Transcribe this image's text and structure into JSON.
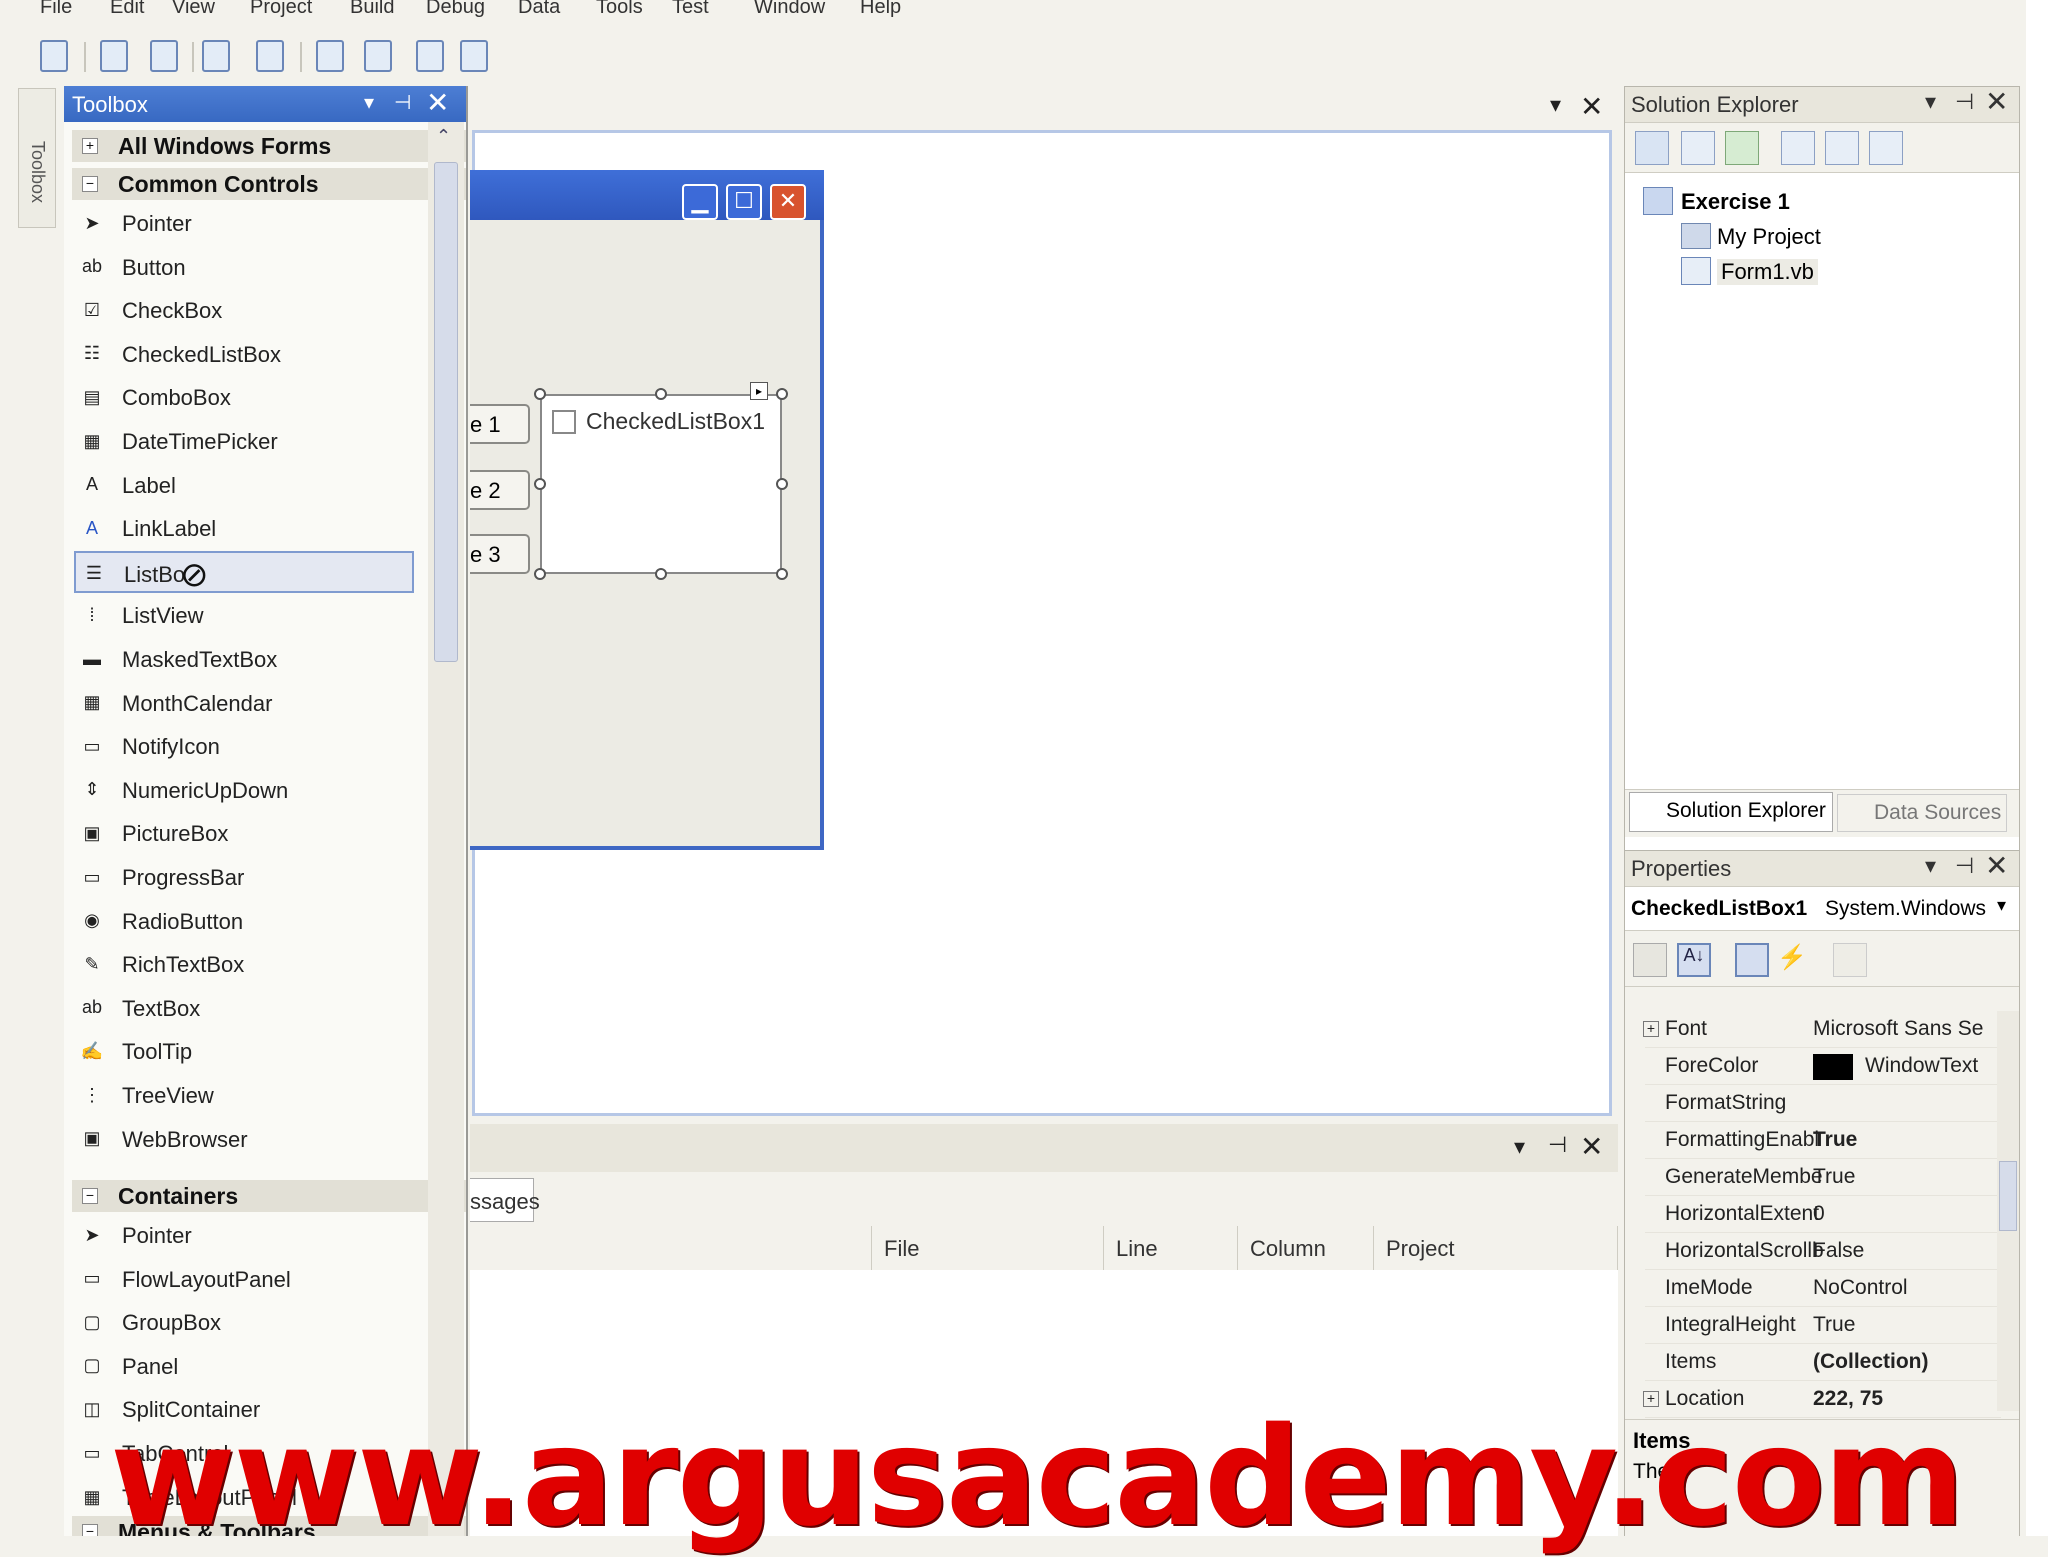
{
  "menu": [
    "File",
    "Edit",
    "View",
    "Project",
    "Build",
    "Debug",
    "Data",
    "Tools",
    "Test",
    "Window",
    "Help"
  ],
  "toolbox": {
    "title": "Toolbox",
    "side_tab": "Toolbox",
    "categories": [
      {
        "label": "All Windows Forms",
        "expanded": false
      },
      {
        "label": "Common Controls",
        "expanded": true
      },
      {
        "label": "Containers",
        "expanded": true
      },
      {
        "label": "Menus & Toolbars",
        "expanded": true
      }
    ],
    "common_controls": [
      "Pointer",
      "Button",
      "CheckBox",
      "CheckedListBox",
      "ComboBox",
      "DateTimePicker",
      "Label",
      "LinkLabel",
      "ListBox",
      "ListView",
      "MaskedTextBox",
      "MonthCalendar",
      "NotifyIcon",
      "NumericUpDown",
      "PictureBox",
      "ProgressBar",
      "RadioButton",
      "RichTextBox",
      "TextBox",
      "ToolTip",
      "TreeView",
      "WebBrowser"
    ],
    "containers": [
      "Pointer",
      "FlowLayoutPanel",
      "GroupBox",
      "Panel",
      "SplitContainer",
      "TabControl",
      "TableLayoutPanel"
    ],
    "selected": "ListBox",
    "selected_visible": "ListBo"
  },
  "designer": {
    "form_buttons": [
      "e 1",
      "e 2",
      "e 3"
    ],
    "checked_list_box": "CheckedListBox1"
  },
  "output": {
    "tab_partial": "ssages",
    "columns": [
      "File",
      "Line",
      "Column",
      "Project"
    ]
  },
  "solution_explorer": {
    "title": "Solution Explorer",
    "tree": [
      "Exercise 1",
      "My Project",
      "Form1.vb"
    ],
    "tabs": [
      "Solution Explorer",
      "Data Sources"
    ]
  },
  "properties": {
    "title": "Properties",
    "object_name": "CheckedListBox1",
    "object_type": "System.Windows",
    "rows": [
      {
        "name": "Font",
        "value": "Microsoft Sans Se",
        "expander": true,
        "bold": false
      },
      {
        "name": "ForeColor",
        "value": "WindowText",
        "swatch": "#000000",
        "bold": false
      },
      {
        "name": "FormatString",
        "value": "",
        "bold": false
      },
      {
        "name": "FormattingEnabl",
        "value": "True",
        "bold": true
      },
      {
        "name": "GenerateMembe",
        "value": "True",
        "bold": false
      },
      {
        "name": "HorizontalExtent",
        "value": "0",
        "bold": false
      },
      {
        "name": "HorizontalScrollb",
        "value": "False",
        "bold": false
      },
      {
        "name": "ImeMode",
        "value": "NoControl",
        "bold": false
      },
      {
        "name": "IntegralHeight",
        "value": "True",
        "bold": false
      },
      {
        "name": "Items",
        "value": "(Collection)",
        "bold": true
      },
      {
        "name": "Location",
        "value": "222, 75",
        "expander": true,
        "bold": true
      }
    ],
    "desc_title": "Items",
    "desc_text": "The"
  },
  "watermark": "www.argusacademy.com",
  "colors": {
    "accent": "#3869c2",
    "watermark": "#e00000"
  }
}
